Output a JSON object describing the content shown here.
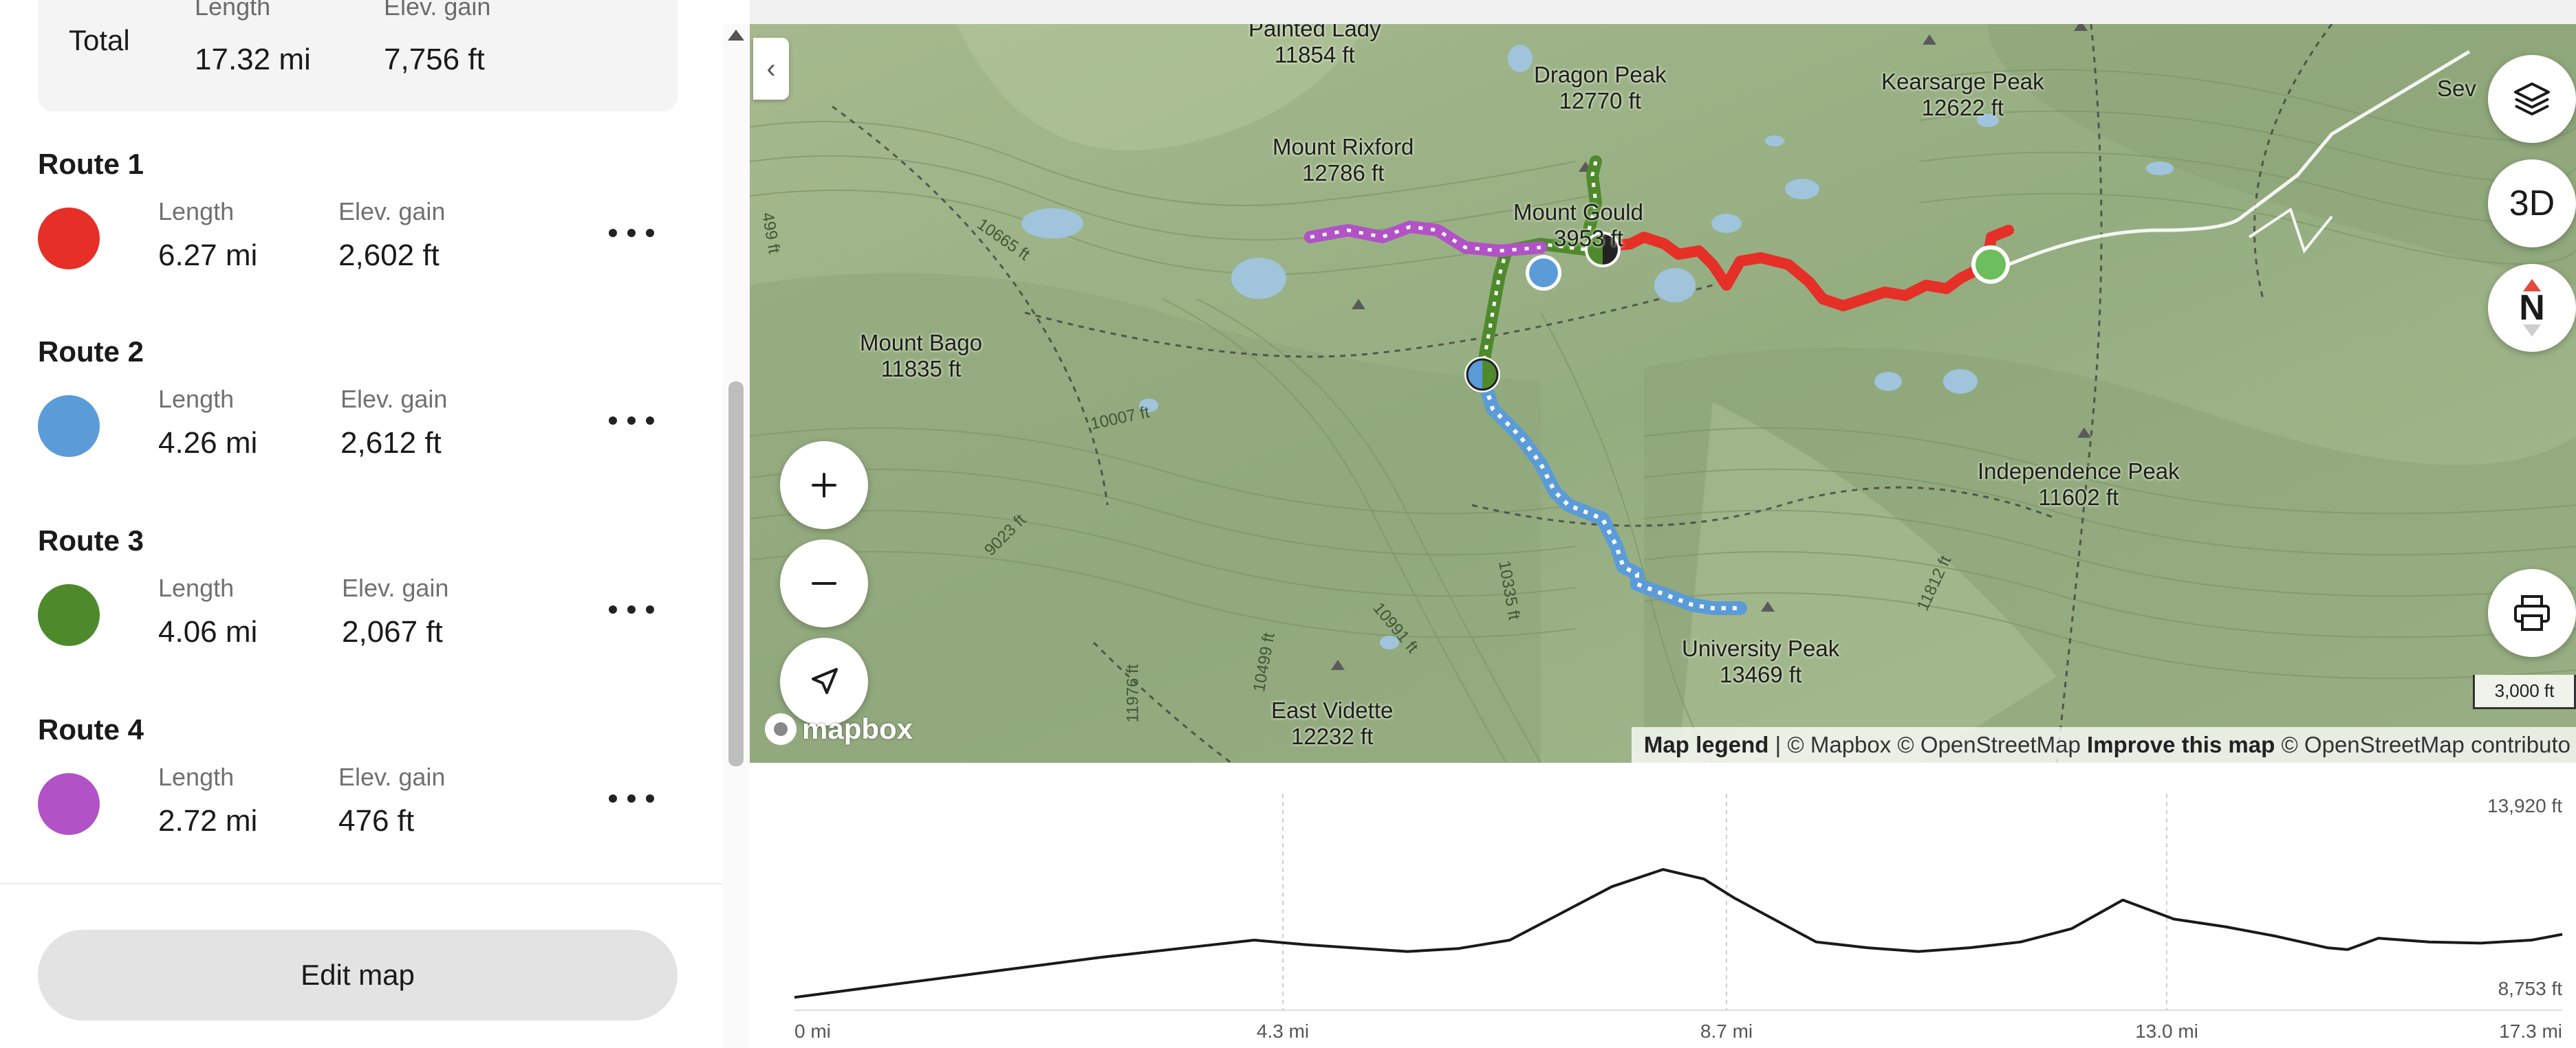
{
  "total": {
    "label": "Total",
    "length_label": "Length",
    "gain_label": "Elev. gain",
    "length": "17.32 mi",
    "gain": "7,756 ft"
  },
  "routes": [
    {
      "title": "Route 1",
      "color": "#e52f27",
      "length_label": "Length",
      "length": "6.27 mi",
      "gain_label": "Elev. gain",
      "gain": "2,602 ft"
    },
    {
      "title": "Route 2",
      "color": "#5b9bd8",
      "length_label": "Length",
      "length": "4.26 mi",
      "gain_label": "Elev. gain",
      "gain": "2,612 ft"
    },
    {
      "title": "Route 3",
      "color": "#4e8a2c",
      "length_label": "Length",
      "length": "4.06 mi",
      "gain_label": "Elev. gain",
      "gain": "2,067 ft"
    },
    {
      "title": "Route 4",
      "color": "#b152c6",
      "length_label": "Length",
      "length": "2.72 mi",
      "gain_label": "Elev. gain",
      "gain": "476 ft"
    }
  ],
  "edit_button": "Edit map",
  "map": {
    "peaks": [
      {
        "name": "Painted Lady",
        "elev": "11854 ft"
      },
      {
        "name": "Dragon Peak",
        "elev": "12770 ft"
      },
      {
        "name": "Kearsarge Peak",
        "elev": "12622 ft"
      },
      {
        "name": "Mount Rixford",
        "elev": "12786 ft"
      },
      {
        "name": "Mount Gould",
        "elev": "3953 ft"
      },
      {
        "name": "Mount Bago",
        "elev": "11835 ft"
      },
      {
        "name": "Independence Peak",
        "elev": "11602 ft"
      },
      {
        "name": "University Peak",
        "elev": "13469 ft"
      },
      {
        "name": "East Vidette",
        "elev": "12232 ft"
      }
    ],
    "contours": [
      "10665 ft",
      "10007 ft",
      "9023 ft",
      "10335 ft",
      "10991 ft",
      "10499 ft",
      "11976 ft",
      "11812 ft",
      "499 ft",
      "Sev"
    ],
    "three_d_label": "3D",
    "north_label": "N",
    "logo_text": "mapbox",
    "scale_label": "3,000 ft",
    "attribution": {
      "legend": "Map legend",
      "sep": " | ",
      "mapbox": "© Mapbox © OpenStreetMap ",
      "improve": "Improve this map",
      "osm": " © OpenStreetMap contributo"
    },
    "icons": {
      "layers": "layers-icon",
      "print": "print-icon",
      "zoom_in": "plus-icon",
      "zoom_out": "minus-icon",
      "locate": "navigation-arrow-icon",
      "collapse": "chevron-left-icon"
    }
  },
  "chart_data": {
    "type": "line",
    "title": "",
    "xlabel": "",
    "ylabel": "",
    "x_ticks": [
      "0 mi",
      "4.3 mi",
      "8.7 mi",
      "13.0 mi",
      "17.3 mi"
    ],
    "y_ticks": [
      "13,920 ft",
      "8,753 ft"
    ],
    "xlim": [
      0,
      17.3
    ],
    "ylim": [
      8753,
      13920
    ],
    "grid": "vertical dashed",
    "series": [
      {
        "x": [
          0,
          1,
          2,
          3,
          4,
          4.5,
          5,
          6,
          6.5,
          7,
          7.5,
          8,
          8.5,
          8.9,
          9.2,
          10,
          10.5,
          11,
          11.5,
          12,
          12.5,
          13,
          13.5,
          14,
          14.5,
          15,
          15.2,
          15.5,
          16,
          16.5,
          17,
          17.3
        ],
        "y": [
          9000,
          9350,
          9700,
          10050,
          10350,
          10500,
          10380,
          10200,
          10280,
          10500,
          11200,
          11900,
          12350,
          12100,
          11600,
          10450,
          10300,
          10200,
          10300,
          10450,
          10800,
          11550,
          11050,
          10850,
          10600,
          10300,
          10250,
          10550,
          10450,
          10420,
          10500,
          10650
        ]
      }
    ]
  }
}
